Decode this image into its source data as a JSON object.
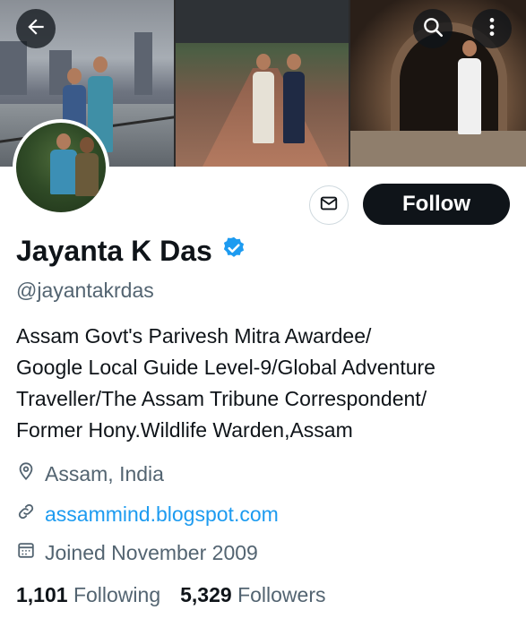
{
  "header": {
    "back_icon": "arrow-left-icon",
    "search_icon": "search-icon",
    "more_icon": "more-vertical-icon"
  },
  "banner": {
    "photo_count": 3
  },
  "actions": {
    "message_icon": "mail-icon",
    "follow_label": "Follow"
  },
  "profile": {
    "display_name": "Jayanta K Das",
    "verified": true,
    "verified_color": "#1d9bf0",
    "handle": "@jayantakrdas",
    "bio_lines": [
      "Assam Govt's Parivesh Mitra Awardee/",
      "Google Local Guide Level-9/Global Adventure",
      "Traveller/The Assam Tribune Correspondent/",
      "Former Hony.Wildlife Warden,Assam"
    ],
    "location": "Assam, India",
    "website": "assammind.blogspot.com",
    "joined": "Joined November 2009"
  },
  "stats": {
    "following_count": "1,101",
    "following_label": "Following",
    "followers_count": "5,329",
    "followers_label": "Followers"
  },
  "colors": {
    "accent": "#1d9bf0",
    "text_primary": "#0f1419",
    "text_secondary": "#536471",
    "follow_bg": "#0f1419"
  }
}
